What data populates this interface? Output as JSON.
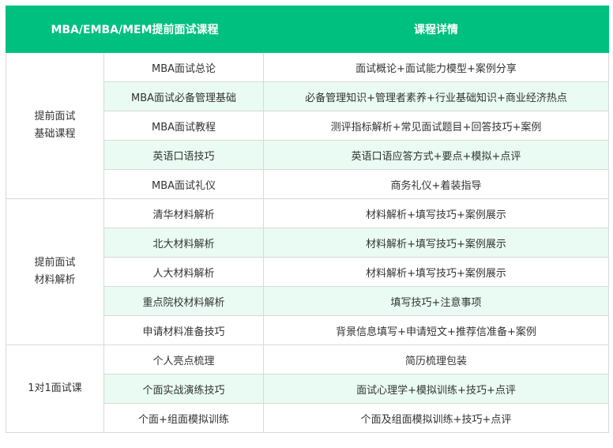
{
  "header": {
    "col1": "MBA/EMBA/MEM提前面试课程",
    "col2": "课程详情"
  },
  "groups": [
    {
      "name_lines": [
        "提前面试",
        "基础课程"
      ],
      "rows": [
        {
          "item": "MBA面试总论",
          "detail": "面试概论+面试能力模型+案例分享"
        },
        {
          "item": "MBA面试必备管理基础",
          "detail": "必备管理知识+管理者素养+行业基础知识+商业经济热点"
        },
        {
          "item": "MBA面试教程",
          "detail": "测评指标解析+常见面试题目+回答技巧+案例"
        },
        {
          "item": "英语口语技巧",
          "detail": "英语口语应答方式+要点+模拟+点评"
        },
        {
          "item": "MBA面试礼仪",
          "detail": "商务礼仪+着装指导"
        }
      ]
    },
    {
      "name_lines": [
        "提前面试",
        "材料解析"
      ],
      "rows": [
        {
          "item": "清华材料解析",
          "detail": "材料解析+填写技巧+案例展示"
        },
        {
          "item": "北大材料解析",
          "detail": "材料解析+填写技巧+案例展示"
        },
        {
          "item": "人大材料解析",
          "detail": "材料解析+填写技巧+案例展示"
        },
        {
          "item": "重点院校材料解析",
          "detail": "填写技巧+注意事项"
        },
        {
          "item": "申请材料准备技巧",
          "detail": "背景信息填写+申请短文+推荐信准备+案例"
        }
      ]
    },
    {
      "name_lines": [
        "1对1面试课"
      ],
      "rows": [
        {
          "item": "个人亮点梳理",
          "detail": "简历梳理包装"
        },
        {
          "item": "个面实战演练技巧",
          "detail": "面试心理学+模拟训练+技巧+点评"
        },
        {
          "item": "个面+组面模拟训练",
          "detail": "个面及组面模拟训练+技巧+点评"
        }
      ]
    }
  ],
  "colors": {
    "header_bg": "#00c07f",
    "alt_row_bg": "#e9fbf2",
    "border": "#d9d9d9"
  }
}
